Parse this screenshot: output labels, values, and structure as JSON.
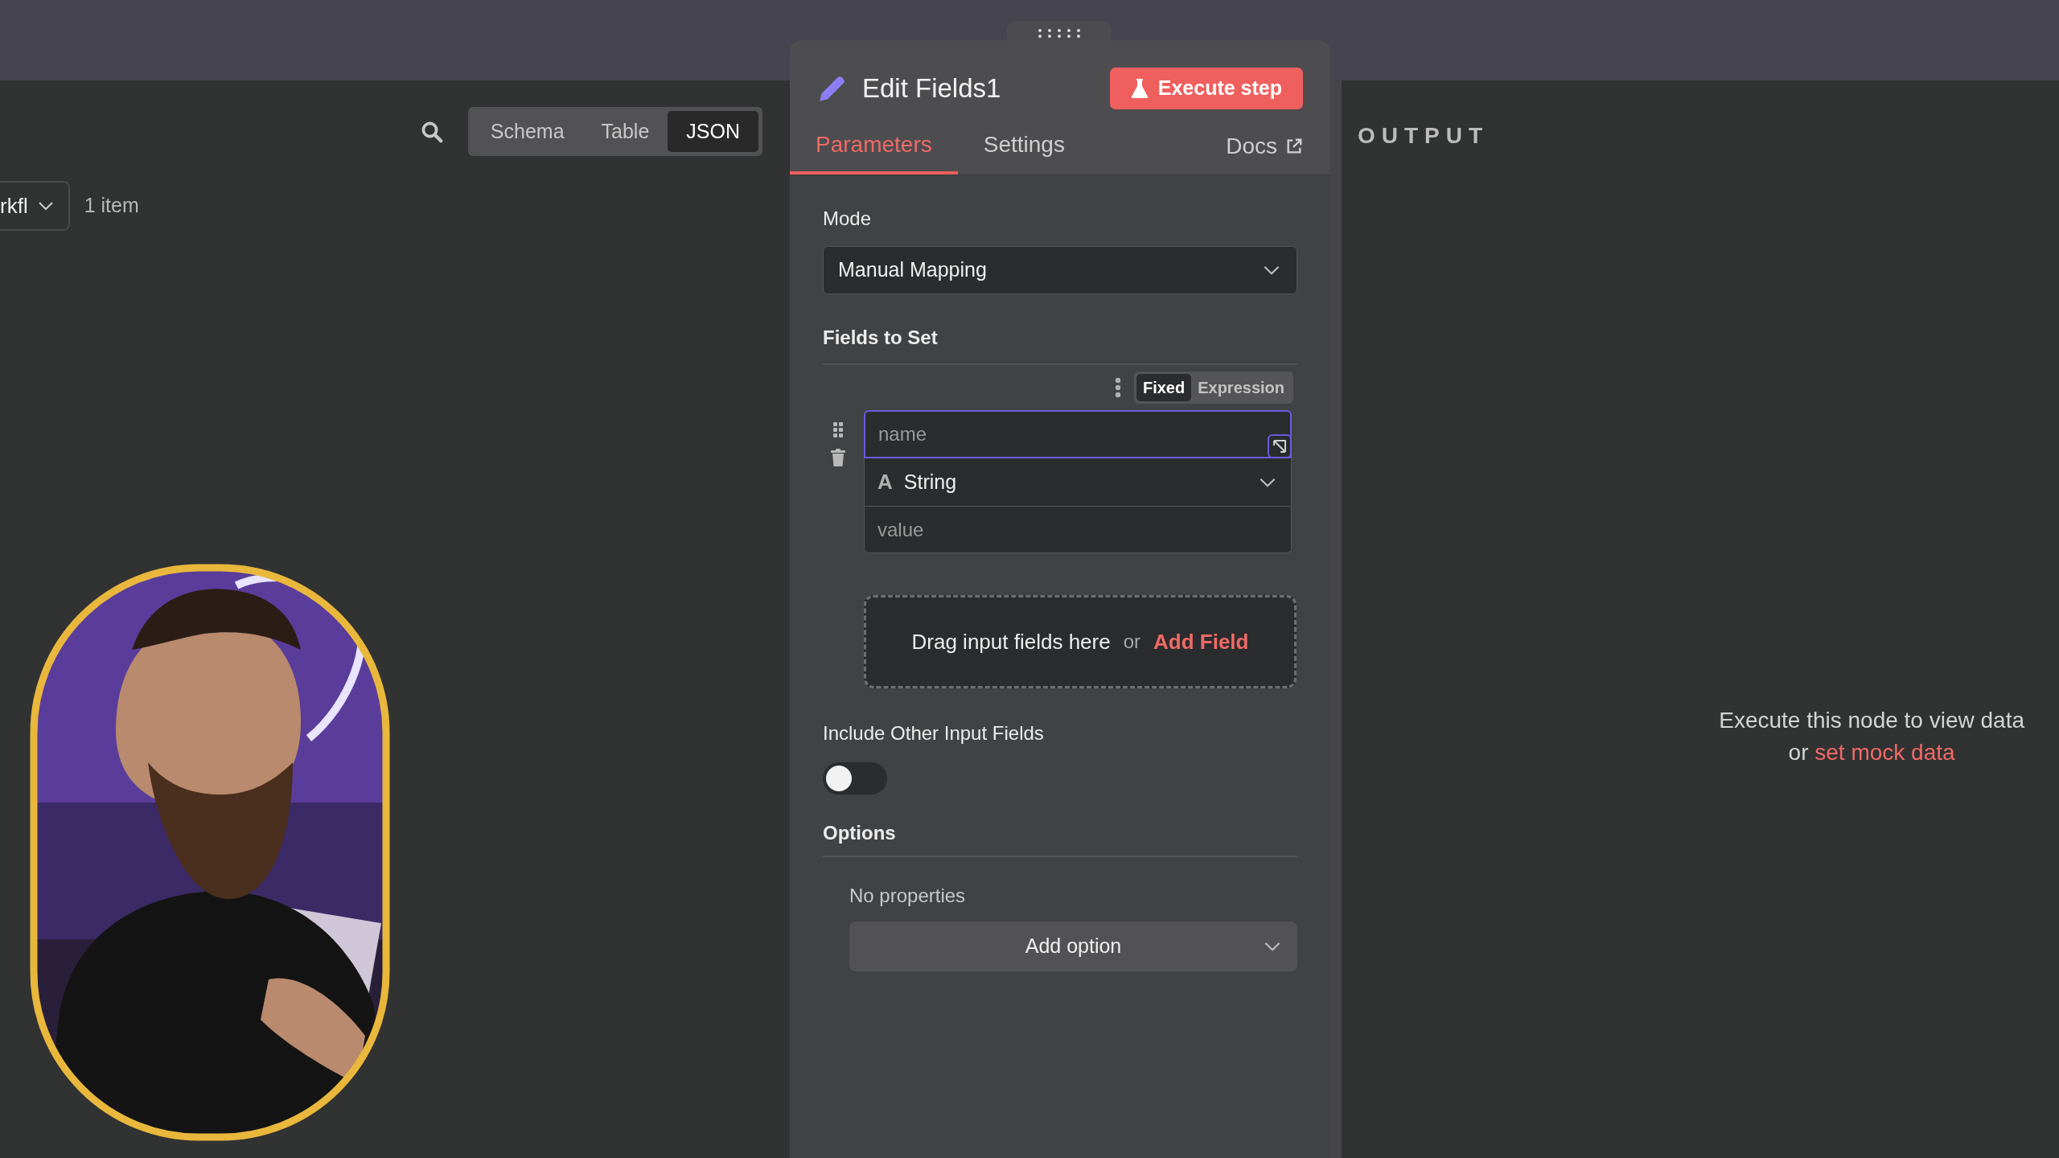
{
  "input_panel": {
    "view_tabs": [
      {
        "label": "Schema",
        "selected": false
      },
      {
        "label": "Table",
        "selected": false
      },
      {
        "label": "JSON",
        "selected": true
      }
    ],
    "node_selector": {
      "value": "rkfl"
    },
    "item_count": "1 item"
  },
  "node_panel": {
    "title": "Edit Fields1",
    "execute_button": "Execute step",
    "tabs": [
      {
        "label": "Parameters",
        "selected": true
      },
      {
        "label": "Settings",
        "selected": false
      }
    ],
    "docs_link": "Docs",
    "mode": {
      "label": "Mode",
      "value": "Manual Mapping"
    },
    "fields_to_set": {
      "label": "Fields to Set",
      "value_mode": [
        {
          "label": "Fixed",
          "selected": true
        },
        {
          "label": "Expression",
          "selected": false
        }
      ],
      "fields": [
        {
          "name": {
            "placeholder": "name",
            "focused": true
          },
          "type_icon": "A",
          "type": "String",
          "value": {
            "placeholder": "value"
          }
        }
      ],
      "drop_zone": {
        "text": "Drag input fields here",
        "or": "or",
        "link": "Add Field"
      }
    },
    "include_other": {
      "label": "Include Other Input Fields",
      "on": false
    },
    "options": {
      "label": "Options",
      "empty": "No properties",
      "add_button": "Add option"
    }
  },
  "output_panel": {
    "heading": "OUTPUT",
    "message": "Execute this node to view data",
    "or": "or",
    "link": "set mock data"
  }
}
